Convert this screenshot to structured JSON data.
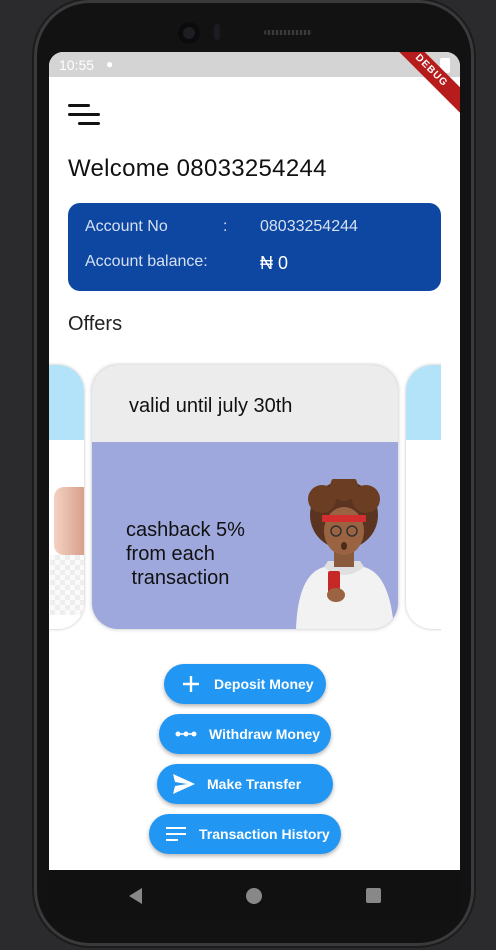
{
  "status_bar": {
    "time": "10:55",
    "debug_label": "DEBUG"
  },
  "header": {
    "welcome": "Welcome 08033254244"
  },
  "account": {
    "number_label": "Account No",
    "separator": ":",
    "number_value": "08033254244",
    "balance_label": "Account balance:",
    "balance_value": "₦ 0"
  },
  "offers": {
    "title": "Offers",
    "cards": [
      {
        "valid_text": "valid until july 30th",
        "promo_lines": [
          "cashback 5%",
          "from each",
          " transaction"
        ]
      }
    ]
  },
  "actions": {
    "deposit": "Deposit Money",
    "withdraw": "Withdraw Money",
    "transfer": "Make Transfer",
    "history": "Transaction History"
  },
  "colors": {
    "primary_blue": "#2196f3",
    "account_card": "#0d47a1",
    "offer_card": "#9ea8dc",
    "debug_banner": "#b71c1c"
  }
}
